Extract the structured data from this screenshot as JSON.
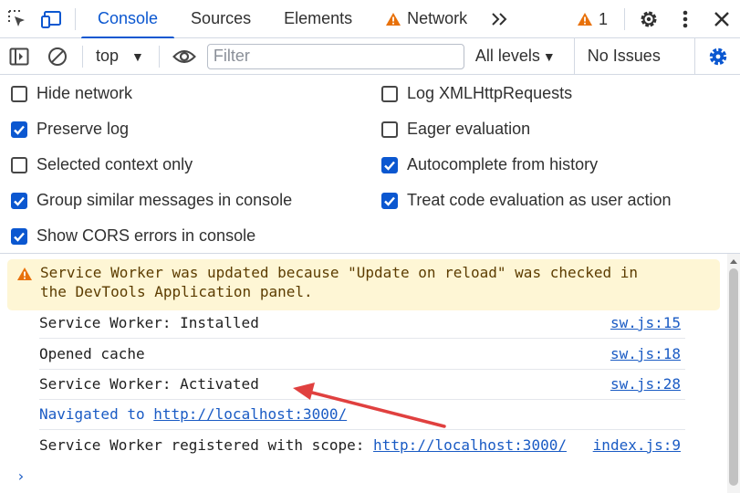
{
  "tabbar": {
    "tabs": [
      {
        "label": "Console",
        "active": true
      },
      {
        "label": "Sources",
        "active": false
      },
      {
        "label": "Elements",
        "active": false
      },
      {
        "label": "Network",
        "active": false,
        "icon": "warning-icon"
      }
    ],
    "more_tabs_icon": "chevrons-right-icon",
    "issues_count": "1",
    "icons": {
      "inspect": "inspect-element-icon",
      "device": "device-toolbar-icon",
      "settings": "gear-icon",
      "menu": "kebab-menu-icon",
      "close": "close-icon"
    }
  },
  "toolbar": {
    "context": "top",
    "filter_placeholder": "Filter",
    "filter_value": "",
    "levels": "All levels",
    "issues": "No Issues"
  },
  "settings": {
    "left": [
      {
        "label": "Hide network",
        "checked": false
      },
      {
        "label": "Preserve log",
        "checked": true
      },
      {
        "label": "Selected context only",
        "checked": false
      },
      {
        "label": "Group similar messages in console",
        "checked": true
      },
      {
        "label": "Show CORS errors in console",
        "checked": true
      }
    ],
    "right": [
      {
        "label": "Log XMLHttpRequests",
        "checked": false
      },
      {
        "label": "Eager evaluation",
        "checked": false
      },
      {
        "label": "Autocomplete from history",
        "checked": true
      },
      {
        "label": "Treat code evaluation as user action",
        "checked": true
      }
    ]
  },
  "console": {
    "warning": {
      "line1": "Service Worker was updated because \"Update on reload\" was checked in",
      "line2": "the DevTools Application panel."
    },
    "logs": [
      {
        "text": "Service Worker: Installed",
        "source": "sw.js:15"
      },
      {
        "text": "Opened cache",
        "source": "sw.js:18"
      },
      {
        "text": "Service Worker: Activated",
        "source": "sw.js:28"
      }
    ],
    "navigated": {
      "text": "Navigated to ",
      "link": "http://localhost:3000/"
    },
    "registered": {
      "text": "Service Worker registered with scope: ",
      "link": "http://localhost:3000/",
      "source": "index.js:9"
    },
    "prompt": "›"
  },
  "colors": {
    "accent": "#0b57d0",
    "warning": "#e8710a",
    "annotation_arrow": "#e0403f"
  }
}
